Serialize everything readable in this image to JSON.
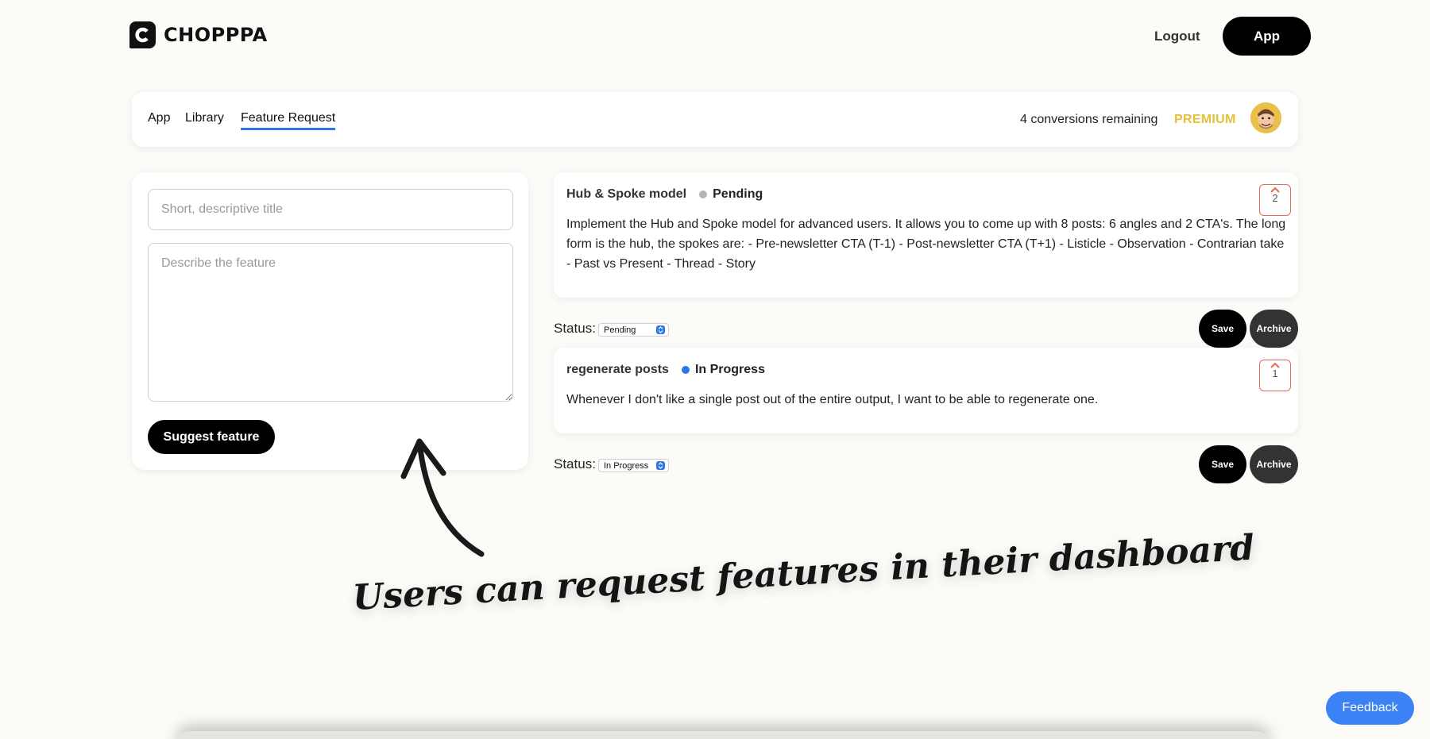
{
  "header": {
    "brand": "CHOPPPA",
    "logout_label": "Logout",
    "app_label": "App"
  },
  "nav": {
    "tabs": [
      {
        "label": "App",
        "active": false
      },
      {
        "label": "Library",
        "active": false
      },
      {
        "label": "Feature Request",
        "active": true
      }
    ],
    "conversions_remaining": "4 conversions remaining",
    "plan": "PREMIUM"
  },
  "form": {
    "title_placeholder": "Short, descriptive title",
    "title_value": "",
    "description_placeholder": "Describe the feature",
    "description_value": "",
    "submit_label": "Suggest feature"
  },
  "features": [
    {
      "title": "Hub & Spoke model",
      "status": "Pending",
      "status_color": "#b5b5b5",
      "description": "Implement the Hub and Spoke model for advanced users. It allows you to come up with 8 posts: 6 angles and 2 CTA's. The long form is the hub, the spokes are: - Pre-newsletter CTA (T-1) - Post-newsletter CTA (T+1) - Listicle - Observation - Contrarian take - Past vs Present - Thread - Story",
      "votes": "2",
      "status_label": "Status:",
      "select_value": "Pending",
      "save_label": "Save",
      "archive_label": "Archive"
    },
    {
      "title": "regenerate posts",
      "status": "In Progress",
      "status_color": "#2e76e6",
      "description": "Whenever I don't like a single post out of the entire output, I want to be able to regenerate one.",
      "votes": "1",
      "status_label": "Status:",
      "select_value": "In Progress",
      "save_label": "Save",
      "archive_label": "Archive"
    }
  ],
  "annotation": {
    "caption": "Users can request features in their dashboard"
  },
  "feedback_label": "Feedback",
  "colors": {
    "accent_blue": "#2e76e6",
    "premium_gold": "#e6bf3a",
    "vote_border": "#e06a56",
    "feedback_blue": "#3b82f6"
  }
}
